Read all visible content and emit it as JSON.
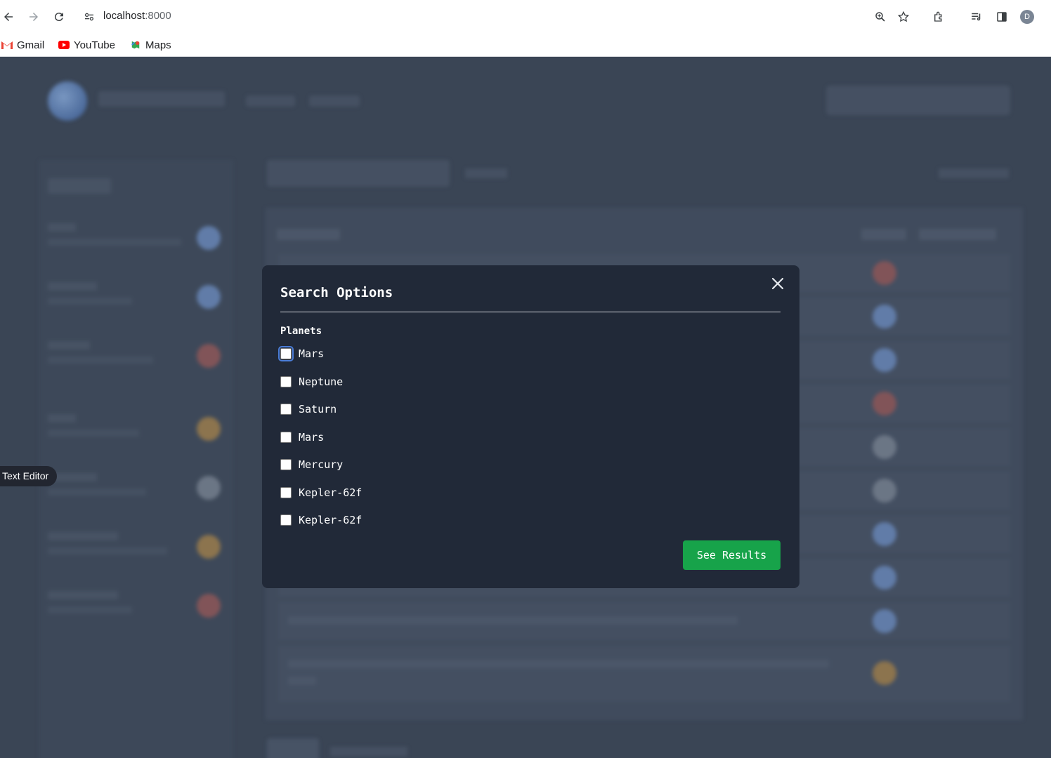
{
  "browser": {
    "url_host": "localhost",
    "url_port": ":8000",
    "profile_initial": "D",
    "bookmarks": [
      {
        "label": "Gmail",
        "icon": "gmail-icon",
        "color": "#ea4335"
      },
      {
        "label": "YouTube",
        "icon": "youtube-icon",
        "color": "#ff0000"
      },
      {
        "label": "Maps",
        "icon": "maps-icon",
        "color": "#34a853"
      }
    ]
  },
  "tooltip": {
    "label": "Text Editor"
  },
  "modal": {
    "title": "Search Options",
    "section_label": "Planets",
    "options": [
      {
        "label": "Mars",
        "checked": false
      },
      {
        "label": "Neptune",
        "checked": false
      },
      {
        "label": "Saturn",
        "checked": false
      },
      {
        "label": "Mars",
        "checked": false
      },
      {
        "label": "Mercury",
        "checked": false
      },
      {
        "label": "Kepler-62f",
        "checked": false
      },
      {
        "label": "Kepler-62f",
        "checked": false
      }
    ],
    "submit_label": "See Results"
  },
  "colors": {
    "modal_bg": "#212938",
    "accent_green": "#17a34a",
    "focus_blue": "#4a7cd6",
    "page_bg": "#3a4555"
  }
}
